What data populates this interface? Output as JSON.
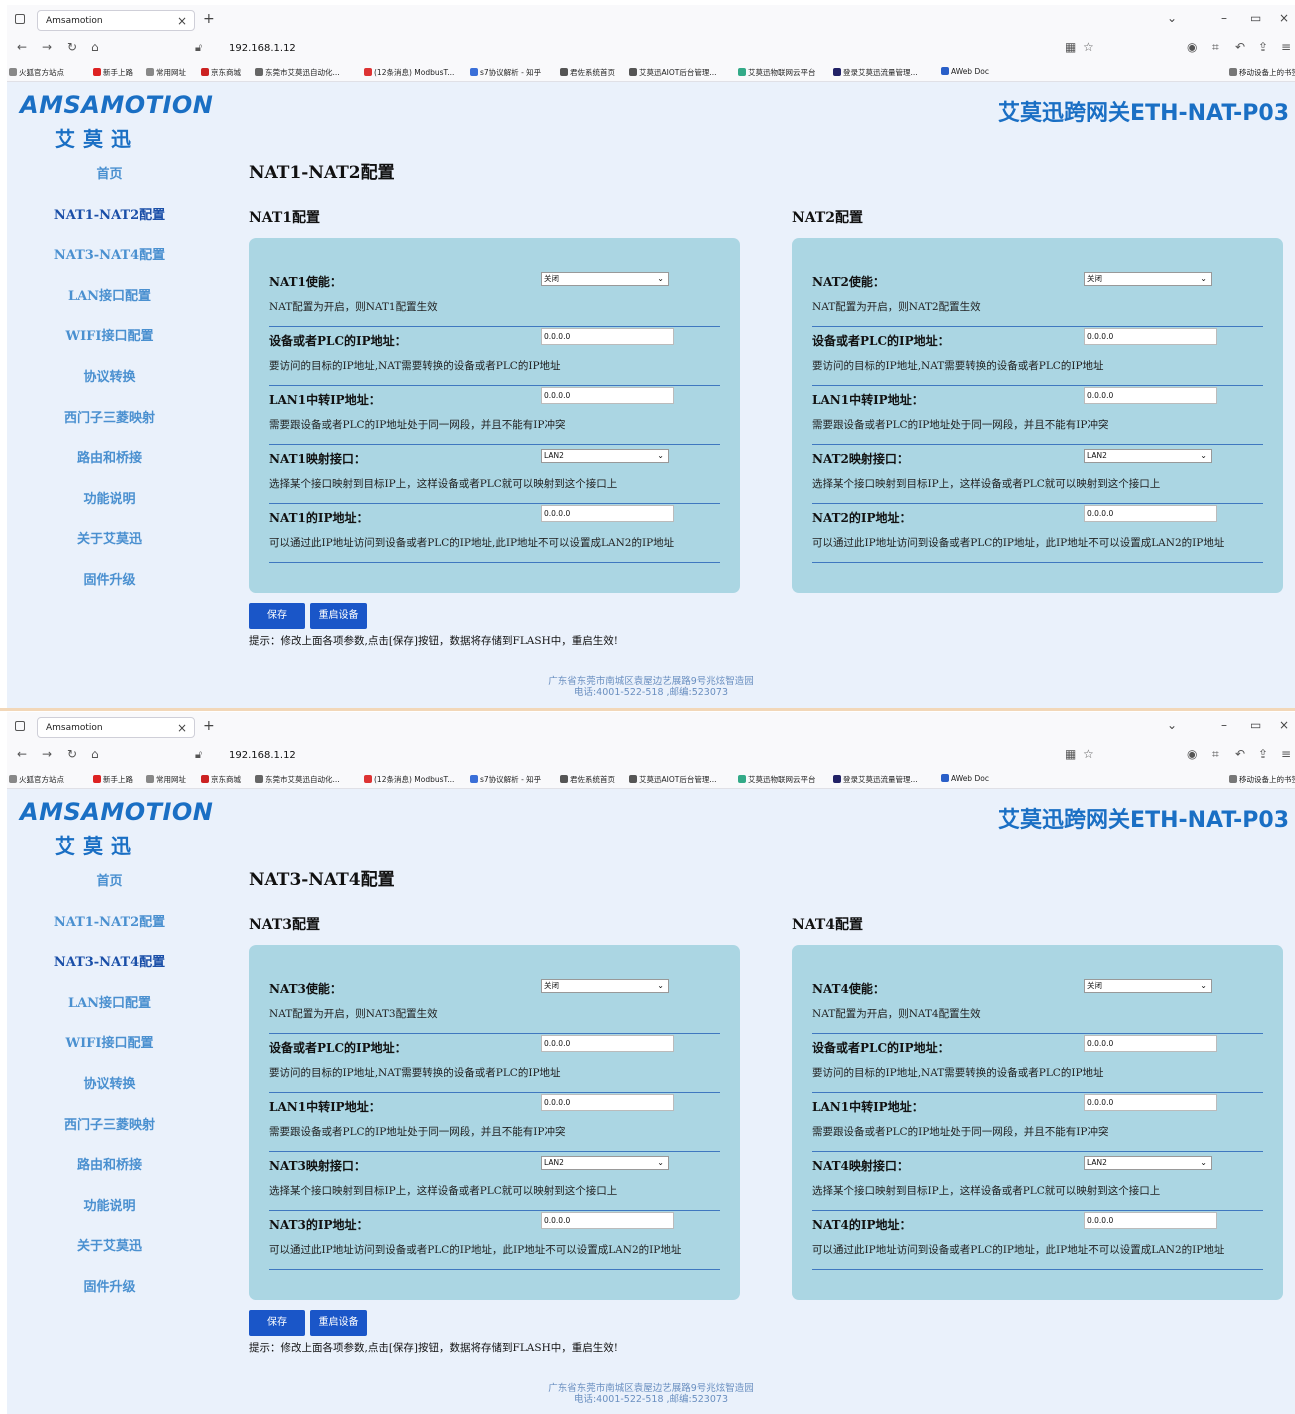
{
  "browser": {
    "tab_title": "Amsamotion",
    "url": "192.168.1.12",
    "bookmarks": [
      "火狐官方站点",
      "新手上路",
      "常用网址",
      "京东商城",
      "东莞市艾莫迅自动化...",
      "(12条消息) ModbusT...",
      "s7协议解析 - 知乎",
      "君佐系统首页",
      "艾莫迅AIOT后台管理...",
      "艾莫迅物联网云平台",
      "登录艾莫迅流量管理...",
      "AWeb Doc",
      "移动设备上的书签"
    ]
  },
  "logo": {
    "en": "AMSAMOTION",
    "cn": "艾莫迅"
  },
  "device_title": "艾莫迅跨网关ETH-NAT-P03",
  "sidebar": {
    "items": [
      {
        "label": "首页"
      },
      {
        "label": "NAT1-NAT2配置"
      },
      {
        "label": "NAT3-NAT4配置"
      },
      {
        "label": "LAN接口配置"
      },
      {
        "label": "WIFI接口配置"
      },
      {
        "label": "协议转换"
      },
      {
        "label": "西门子三菱映射"
      },
      {
        "label": "路由和桥接"
      },
      {
        "label": "功能说明"
      },
      {
        "label": "关于艾莫迅"
      },
      {
        "label": "固件升级"
      }
    ]
  },
  "screens": [
    {
      "section_title": "NAT1-NAT2配置",
      "active_item": 1,
      "panels": [
        {
          "title": "NAT1配置",
          "rows": [
            {
              "label": "NAT1使能：",
              "kind": "select",
              "value": "关闭",
              "hint": "NAT配置为开启，则NAT1配置生效"
            },
            {
              "label": "设备或者PLC的IP地址：",
              "kind": "input",
              "value": "0.0.0.0",
              "hint": "要访问的目标的IP地址,NAT需要转换的设备或者PLC的IP地址"
            },
            {
              "label": "LAN1中转IP地址：",
              "kind": "input",
              "value": "0.0.0.0",
              "hint": "需要跟设备或者PLC的IP地址处于同一网段，并且不能有IP冲突"
            },
            {
              "label": "NAT1映射接口：",
              "kind": "select",
              "value": "LAN2",
              "hint": "选择某个接口映射到目标IP上，这样设备或者PLC就可以映射到这个接口上"
            },
            {
              "label": "NAT1的IP地址：",
              "kind": "input",
              "value": "0.0.0.0",
              "hint": "可以通过此IP地址访问到设备或者PLC的IP地址,此IP地址不可以设置成LAN2的IP地址"
            }
          ]
        },
        {
          "title": "NAT2配置",
          "rows": [
            {
              "label": "NAT2使能：",
              "kind": "select",
              "value": "关闭",
              "hint": "NAT配置为开启，则NAT2配置生效"
            },
            {
              "label": "设备或者PLC的IP地址：",
              "kind": "input",
              "value": "0.0.0.0",
              "hint": "要访问的目标的IP地址,NAT需要转换的设备或者PLC的IP地址"
            },
            {
              "label": "LAN1中转IP地址：",
              "kind": "input",
              "value": "0.0.0.0",
              "hint": "需要跟设备或者PLC的IP地址处于同一网段，并且不能有IP冲突"
            },
            {
              "label": "NAT2映射接口：",
              "kind": "select",
              "value": "LAN2",
              "hint": "选择某个接口映射到目标IP上，这样设备或者PLC就可以映射到这个接口上"
            },
            {
              "label": "NAT2的IP地址：",
              "kind": "input",
              "value": "0.0.0.0",
              "hint": "可以通过此IP地址访问到设备或者PLC的IP地址，此IP地址不可以设置成LAN2的IP地址"
            }
          ]
        }
      ]
    },
    {
      "section_title": "NAT3-NAT4配置",
      "active_item": 2,
      "panels": [
        {
          "title": "NAT3配置",
          "rows": [
            {
              "label": "NAT3使能：",
              "kind": "select",
              "value": "关闭",
              "hint": "NAT配置为开启，则NAT3配置生效"
            },
            {
              "label": "设备或者PLC的IP地址：",
              "kind": "input",
              "value": "0.0.0.0",
              "hint": "要访问的目标的IP地址,NAT需要转换的设备或者PLC的IP地址"
            },
            {
              "label": "LAN1中转IP地址：",
              "kind": "input",
              "value": "0.0.0.0",
              "hint": "需要跟设备或者PLC的IP地址处于同一网段，并且不能有IP冲突"
            },
            {
              "label": "NAT3映射接口：",
              "kind": "select",
              "value": "LAN2",
              "hint": "选择某个接口映射到目标IP上，这样设备或者PLC就可以映射到这个接口上"
            },
            {
              "label": "NAT3的IP地址：",
              "kind": "input",
              "value": "0.0.0.0",
              "hint": "可以通过此IP地址访问到设备或者PLC的IP地址，此IP地址不可以设置成LAN2的IP地址"
            }
          ]
        },
        {
          "title": "NAT4配置",
          "rows": [
            {
              "label": "NAT4使能：",
              "kind": "select",
              "value": "关闭",
              "hint": "NAT配置为开启，则NAT4配置生效"
            },
            {
              "label": "设备或者PLC的IP地址：",
              "kind": "input",
              "value": "0.0.0.0",
              "hint": "要访问的目标的IP地址,NAT需要转换的设备或者PLC的IP地址"
            },
            {
              "label": "LAN1中转IP地址：",
              "kind": "input",
              "value": "0.0.0.0",
              "hint": "需要跟设备或者PLC的IP地址处于同一网段，并且不能有IP冲突"
            },
            {
              "label": "NAT4映射接口：",
              "kind": "select",
              "value": "LAN2",
              "hint": "选择某个接口映射到目标IP上，这样设备或者PLC就可以映射到这个接口上"
            },
            {
              "label": "NAT4的IP地址：",
              "kind": "input",
              "value": "0.0.0.0",
              "hint": "可以通过此IP地址访问到设备或者PLC的IP地址，此IP地址不可以设置成LAN2的IP地址"
            }
          ]
        }
      ]
    }
  ],
  "buttons": {
    "save": "保存",
    "reboot": "重启设备"
  },
  "tip": "提示：修改上面各项参数,点击[保存]按钮，数据将存储到FLASH中，重启生效!",
  "footer": {
    "address": "广东省东莞市南城区袁屋边艺展路9号兆炫智造园",
    "contact": "电话:4001-522-518 ,邮编:523073"
  },
  "colors": {
    "accent": "#1a6fc4",
    "panel_bg": "#abd6e3",
    "page_bg": "#eaf1fb",
    "button": "#1a56c8"
  }
}
